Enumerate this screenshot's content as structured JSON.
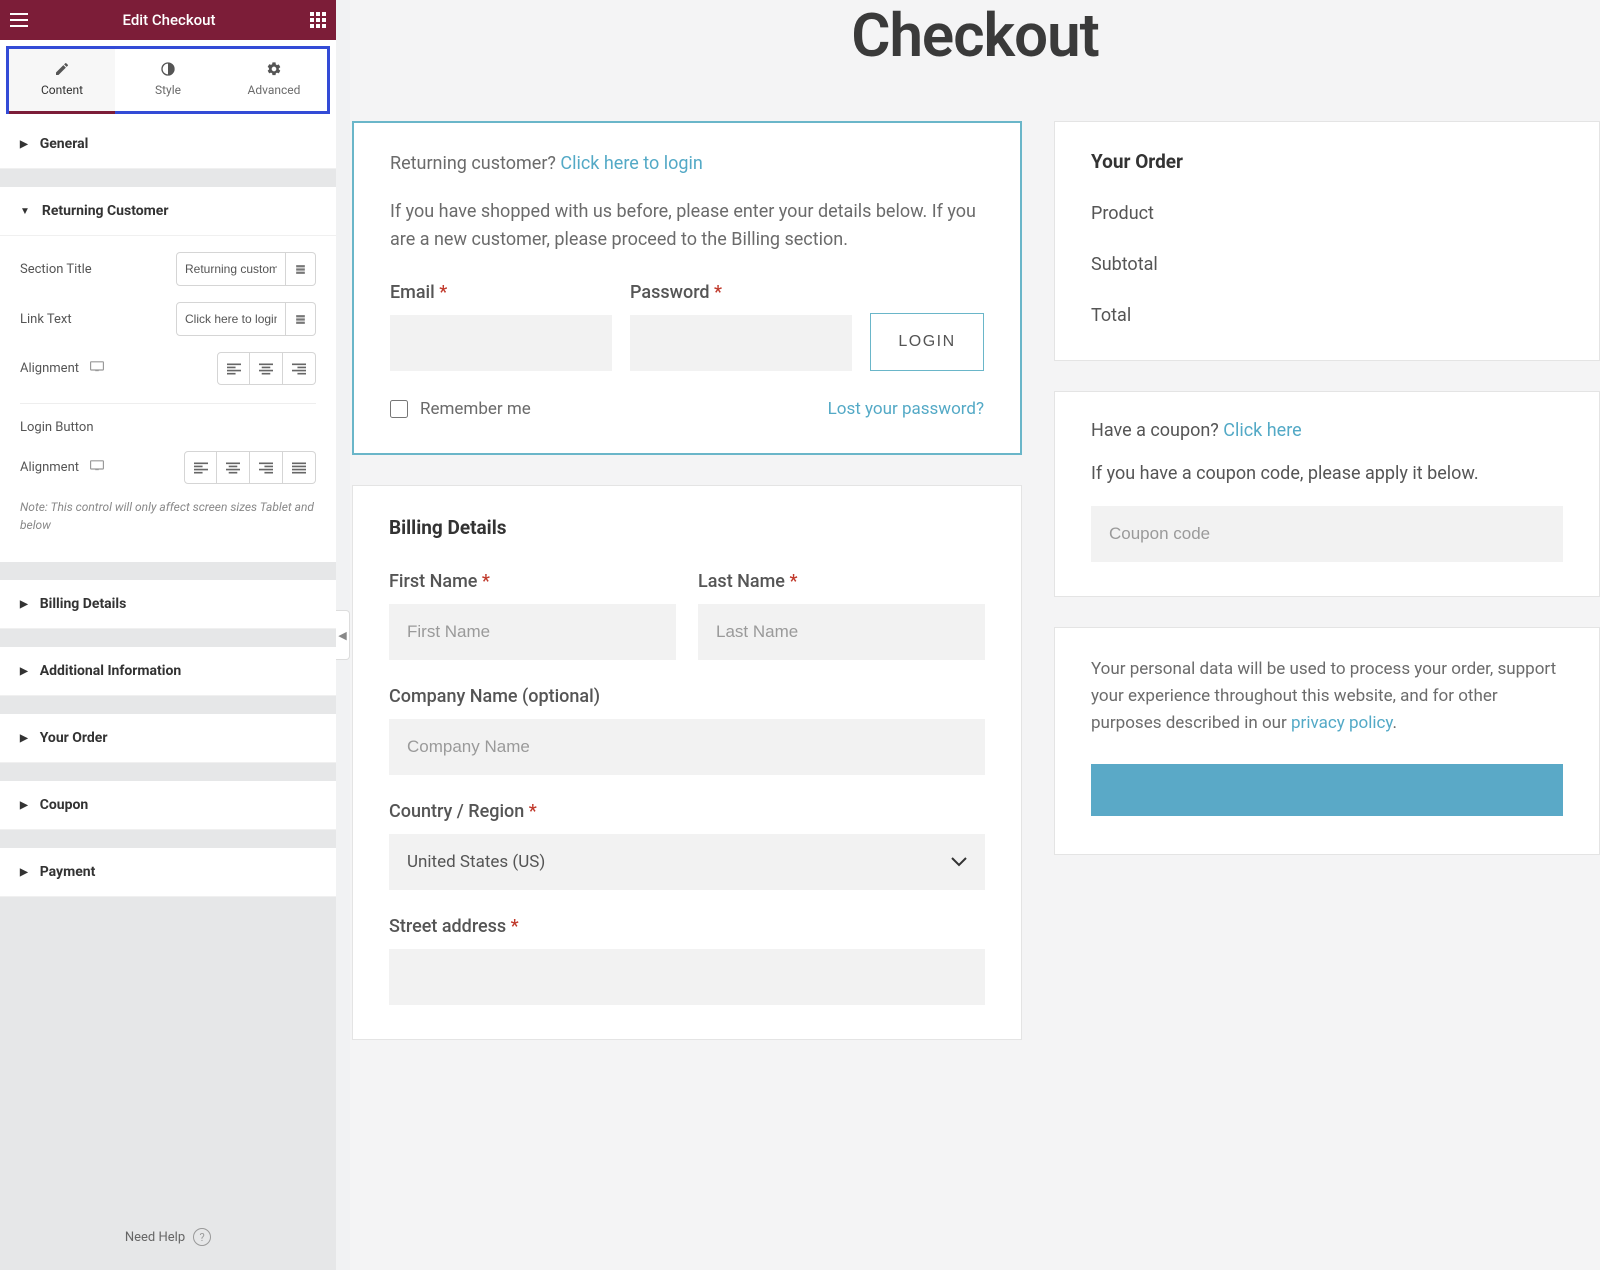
{
  "header": {
    "title": "Edit Checkout"
  },
  "tabs": {
    "content": "Content",
    "style": "Style",
    "advanced": "Advanced"
  },
  "sections": {
    "general": "General",
    "returning_customer": "Returning Customer",
    "billing_details": "Billing Details",
    "additional_information": "Additional Information",
    "your_order": "Your Order",
    "coupon": "Coupon",
    "payment": "Payment"
  },
  "controls": {
    "section_title": {
      "label": "Section Title",
      "value": "Returning customer?"
    },
    "link_text": {
      "label": "Link Text",
      "value": "Click here to login"
    },
    "alignment": {
      "label": "Alignment"
    },
    "login_button_heading": "Login Button",
    "login_alignment": {
      "label": "Alignment"
    },
    "note": "Note: This control will only affect screen sizes Tablet and below"
  },
  "footer": {
    "need_help": "Need Help"
  },
  "page": {
    "title": "Checkout"
  },
  "returning": {
    "prefix": "Returning customer? ",
    "link": "Click here to login",
    "instructions": "If you have shopped with us before, please enter your details below. If you are a new customer, please proceed to the Billing section.",
    "email_label": "Email ",
    "password_label": "Password ",
    "login_btn": "LOGIN",
    "remember": "Remember me",
    "lost_password": "Lost your password?"
  },
  "billing": {
    "heading": "Billing Details",
    "first_name": {
      "label": "First Name ",
      "placeholder": "First Name"
    },
    "last_name": {
      "label": "Last Name ",
      "placeholder": "Last Name"
    },
    "company": {
      "label": "Company Name (optional)",
      "placeholder": "Company Name"
    },
    "country": {
      "label": "Country / Region ",
      "value": "United States (US)"
    },
    "street": {
      "label": "Street address "
    }
  },
  "order": {
    "heading": "Your Order",
    "product": "Product",
    "subtotal": "Subtotal",
    "total": "Total"
  },
  "coupon": {
    "question": "Have a coupon? ",
    "question_link": "Click here",
    "instructions": "If you have a coupon code, please apply it below.",
    "placeholder": "Coupon code"
  },
  "payment": {
    "privacy_prefix": "Your personal data will be used to process your order, support your experience throughout this website, and for other purposes described in our ",
    "privacy_link": "privacy policy"
  }
}
